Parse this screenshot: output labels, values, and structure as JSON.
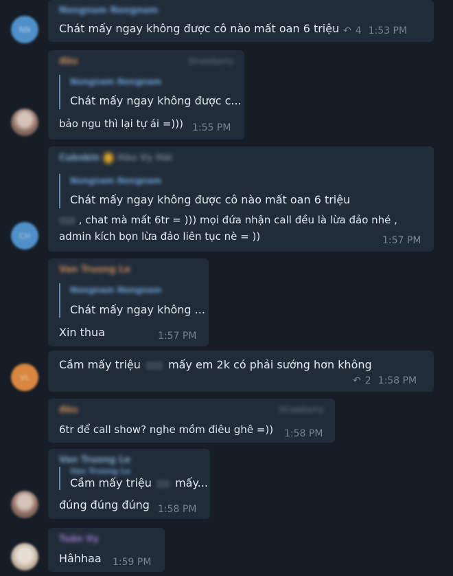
{
  "messages": [
    {
      "id": "m1",
      "avatar_initials": "NN",
      "sender": "Nongnam Nongnam",
      "text": "Chát mấy ngay không được cô nào mất oan 6 triệu",
      "reply_count": "4",
      "time": "1:53 PM"
    },
    {
      "id": "m2",
      "sender": "đầu",
      "tag": "Strawberry",
      "quote_name": "Nongnam Nongnam",
      "quote_text": "Chát mấy ngay không được c...",
      "text": "bảo ngu thì lại tự ái =)))",
      "time": "1:55 PM"
    },
    {
      "id": "m3",
      "avatar_initials": "CH",
      "sender": "Cubsbin",
      "sender_extra": "Hào Vy Hải",
      "quote_name": "Nongnam Nongnam",
      "quote_text": "Chát mấy ngay không được cô nào mất oan 6 triệu",
      "text_line1": ", chat mà mất 6tr = ))) mọi đứa nhận call đều là lừa đảo nhé ,",
      "text_line2": "admin kích bọn lừa đảo liên tục nè = ))",
      "time": "1:57 PM"
    },
    {
      "id": "m4",
      "sender": "Van Truong Le",
      "quote_name": "Nongnam Nongnam",
      "quote_text": "Chát mấy ngay không ...",
      "text": "Xin thua",
      "time": "1:57 PM"
    },
    {
      "id": "m5",
      "avatar_initials": "VL",
      "text_before": "Cầm mấy triệu",
      "text_after": "mấy em 2k có phải sướng hơn không",
      "reply_count": "2",
      "time": "1:58 PM"
    },
    {
      "id": "m6",
      "sender": "đầu",
      "tag": "Strawberry",
      "text": "6tr để call show? nghe mồm điêu ghê =))",
      "time": "1:58 PM"
    },
    {
      "id": "m7",
      "sender": "Van Truong Le",
      "quote_name": "Van Truong Le",
      "quote_before": "Cầm mấy triệu",
      "quote_after": "mấy...",
      "text": "đúng đúng đúng",
      "time": "1:58 PM"
    },
    {
      "id": "m8",
      "sender": "Tuấn Vy",
      "text": "Hâhhaa",
      "time": "1:59 PM"
    }
  ],
  "colors": {
    "background": "#161d27",
    "bubble": "#212c39",
    "reply_bar": "#5b8bb5",
    "sender_blue": "#6fa3d8",
    "timestamp": "#758392"
  },
  "icons": [
    "reply-arrow-icon"
  ]
}
